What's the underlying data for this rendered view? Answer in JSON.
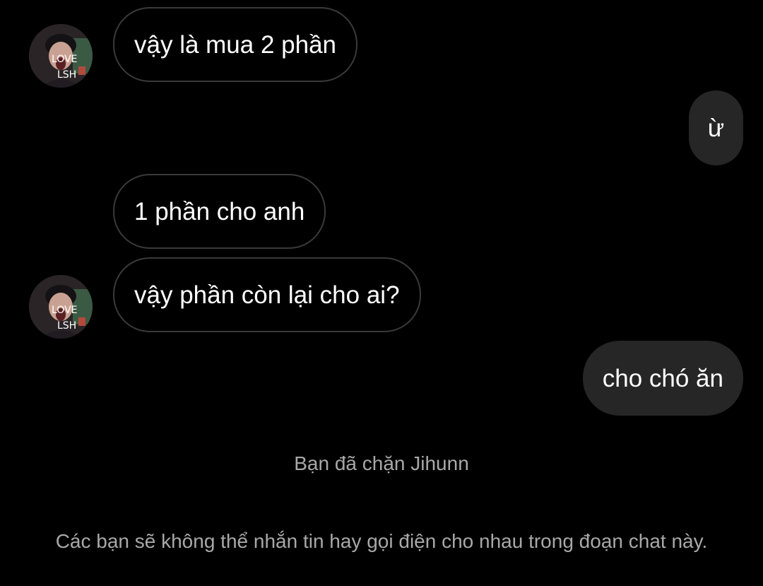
{
  "colors": {
    "background": "#000000",
    "incoming_border": "#3a3a3a",
    "outgoing_bubble": "#262626",
    "notice_text": "#a8a8a8"
  },
  "avatar": {
    "text_line1": "LOVE",
    "text_line2": "LSH"
  },
  "messages": [
    {
      "direction": "incoming",
      "text": "vậy là mua 2 phần"
    },
    {
      "direction": "outgoing",
      "text": "ừ"
    },
    {
      "direction": "incoming",
      "text": "1 phần cho anh"
    },
    {
      "direction": "incoming",
      "text": "vậy phần còn lại cho ai?"
    },
    {
      "direction": "outgoing",
      "text": "cho chó ăn"
    }
  ],
  "notices": {
    "blocked": "Bạn đã chặn Jihunn",
    "blocked_detail": "Các bạn sẽ không thể nhắn tin hay gọi điện cho nhau trong đoạn chat này."
  }
}
